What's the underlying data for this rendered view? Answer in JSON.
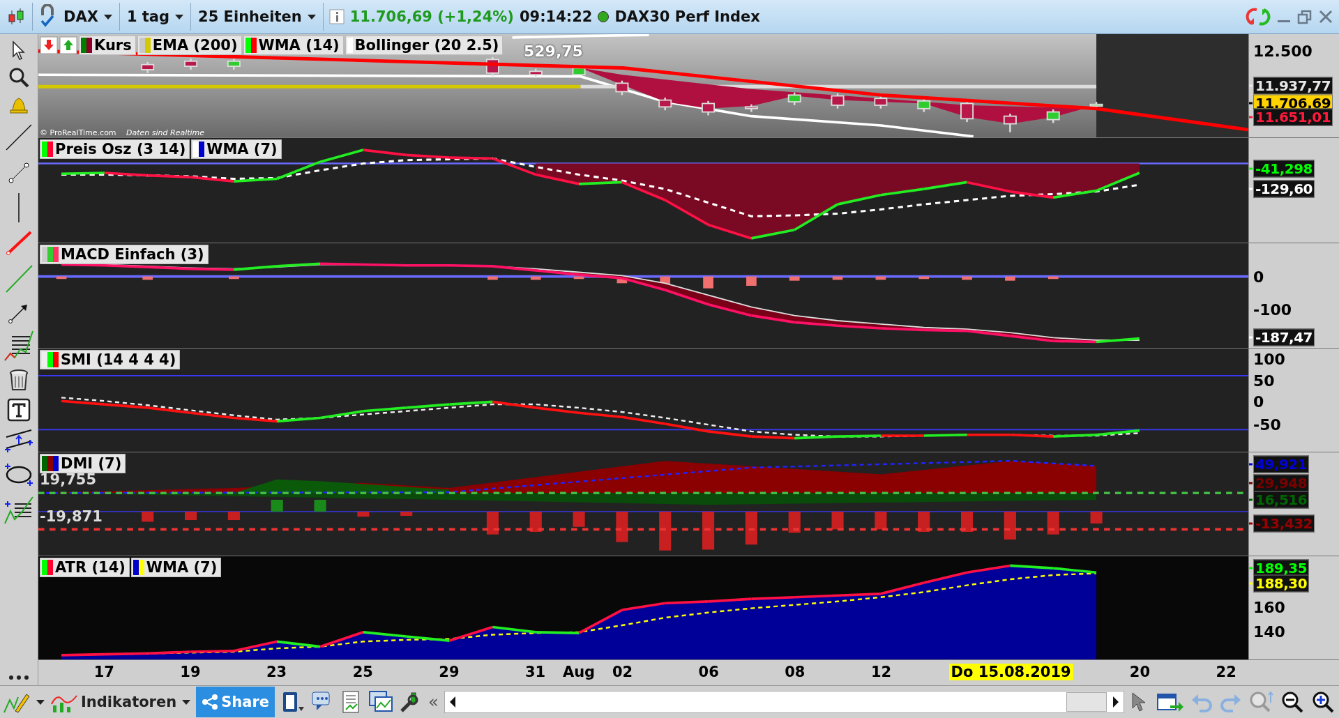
{
  "top_bar": {
    "instrument": "DAX",
    "period": "1 tag",
    "units": "25 Einheiten",
    "price": "11.706,69 (+1,24%)",
    "time": "09:14:22",
    "market_open": true,
    "index_name": "DAX30 Perf Index"
  },
  "chart_panels": [
    {
      "kind": "price",
      "legends": [
        {
          "label": "Kurs",
          "swatches": [
            {
              "color": "#008000"
            },
            {
              "color": "#8b0026"
            }
          ]
        },
        {
          "label": "EMA (200)",
          "swatches": [
            {
              "color": "#c8c8c8"
            },
            {
              "color": "#d4c800"
            }
          ]
        },
        {
          "label": "WMA (14)",
          "swatches": [
            {
              "color": "#00ff00"
            },
            {
              "color": "#ff0000"
            }
          ]
        },
        {
          "label": "Bollinger (20 2.5)",
          "swatches": [
            {
              "color": "#ffffff"
            }
          ]
        }
      ],
      "ghost_label": "529,75",
      "credit": "© ProRealTime.com",
      "credit_note": "Daten sind Realtime",
      "axis": [
        {
          "text": "12.500",
          "kind": "tick"
        },
        {
          "text": "11.937,77",
          "kind": "badge",
          "color": "#e8e8e8"
        },
        {
          "text": "11.706,69",
          "kind": "highlight",
          "color": "#000000"
        },
        {
          "text": "11.651,01",
          "kind": "badge",
          "color": "#ff1a3c"
        }
      ]
    },
    {
      "kind": "oscillator",
      "legends": [
        {
          "label": "Preis Osz (3 14)",
          "swatches": [
            {
              "color": "#00ff00"
            },
            {
              "color": "#ff0033"
            }
          ]
        },
        {
          "label": "WMA (7)",
          "swatches": [
            {
              "color": "#ffffff"
            },
            {
              "color": "#0000cc"
            }
          ]
        }
      ],
      "axis": [
        {
          "text": "-41,298",
          "kind": "badge",
          "color": "#00ff00"
        },
        {
          "text": "-129,60",
          "kind": "badge",
          "color": "#ffffff"
        }
      ]
    },
    {
      "kind": "macd",
      "legends": [
        {
          "label": "MACD Einfach (3)",
          "swatches": [
            {
              "color": "#cccccc"
            },
            {
              "color": "#33cc33"
            },
            {
              "color": "#ff3366"
            }
          ]
        }
      ],
      "axis": [
        {
          "text": "0",
          "kind": "tick"
        },
        {
          "text": "-100",
          "kind": "tick"
        },
        {
          "text": "-187,47",
          "kind": "badge",
          "color": "#ffffff"
        }
      ]
    },
    {
      "kind": "smi",
      "legends": [
        {
          "label": "SMI (14 4 4 4)",
          "swatches": [
            {
              "color": "#eeeeee"
            },
            {
              "color": "#00ff00"
            },
            {
              "color": "#ff0000"
            }
          ]
        }
      ],
      "axis": [
        {
          "text": "100",
          "kind": "tick"
        },
        {
          "text": "50",
          "kind": "tick"
        },
        {
          "text": "0",
          "kind": "tick"
        },
        {
          "text": "-50",
          "kind": "tick"
        }
      ]
    },
    {
      "kind": "dmi",
      "legends": [
        {
          "label": "DMI (7)",
          "swatches": [
            {
              "color": "#006600"
            },
            {
              "color": "#8b0000"
            },
            {
              "color": "#0000cc"
            }
          ]
        }
      ],
      "inner_labels": [
        "19,755",
        "-19,871"
      ],
      "axis": [
        {
          "text": "49,921",
          "kind": "badge",
          "color": "#0000dd"
        },
        {
          "text": "29,948",
          "kind": "badge",
          "color": "#7a0000"
        },
        {
          "text": "16,516",
          "kind": "badge",
          "color": "#006600"
        },
        {
          "text": "-13,432",
          "kind": "badge",
          "color": "#990000"
        }
      ]
    },
    {
      "kind": "atr",
      "legends": [
        {
          "label": "ATR (14)",
          "swatches": [
            {
              "color": "#00ff00"
            },
            {
              "color": "#ff0033"
            }
          ]
        },
        {
          "label": "WMA (7)",
          "swatches": [
            {
              "color": "#0000cc"
            },
            {
              "color": "#ffff00"
            }
          ]
        }
      ],
      "axis": [
        {
          "text": "189,35",
          "kind": "badge",
          "color": "#00ff00"
        },
        {
          "text": "188,30",
          "kind": "badge",
          "color": "#ffff00"
        },
        {
          "text": "160",
          "kind": "tick"
        },
        {
          "text": "140",
          "kind": "tick"
        }
      ]
    }
  ],
  "date_axis": [
    {
      "label": "17",
      "highlighted": false
    },
    {
      "label": "19",
      "highlighted": false
    },
    {
      "label": "23",
      "highlighted": false
    },
    {
      "label": "25",
      "highlighted": false
    },
    {
      "label": "29",
      "highlighted": false
    },
    {
      "label": "31",
      "highlighted": false
    },
    {
      "label": "Aug",
      "highlighted": false
    },
    {
      "label": "02",
      "highlighted": false
    },
    {
      "label": "06",
      "highlighted": false
    },
    {
      "label": "08",
      "highlighted": false
    },
    {
      "label": "12",
      "highlighted": false
    },
    {
      "label": "Do 15.08.2019",
      "highlighted": true
    },
    {
      "label": "20",
      "highlighted": false
    },
    {
      "label": "22",
      "highlighted": false
    }
  ],
  "bottom_toolbar": {
    "indicators_label": "Indikatoren",
    "share_label": "Share",
    "collapse_glyph": "«"
  }
}
